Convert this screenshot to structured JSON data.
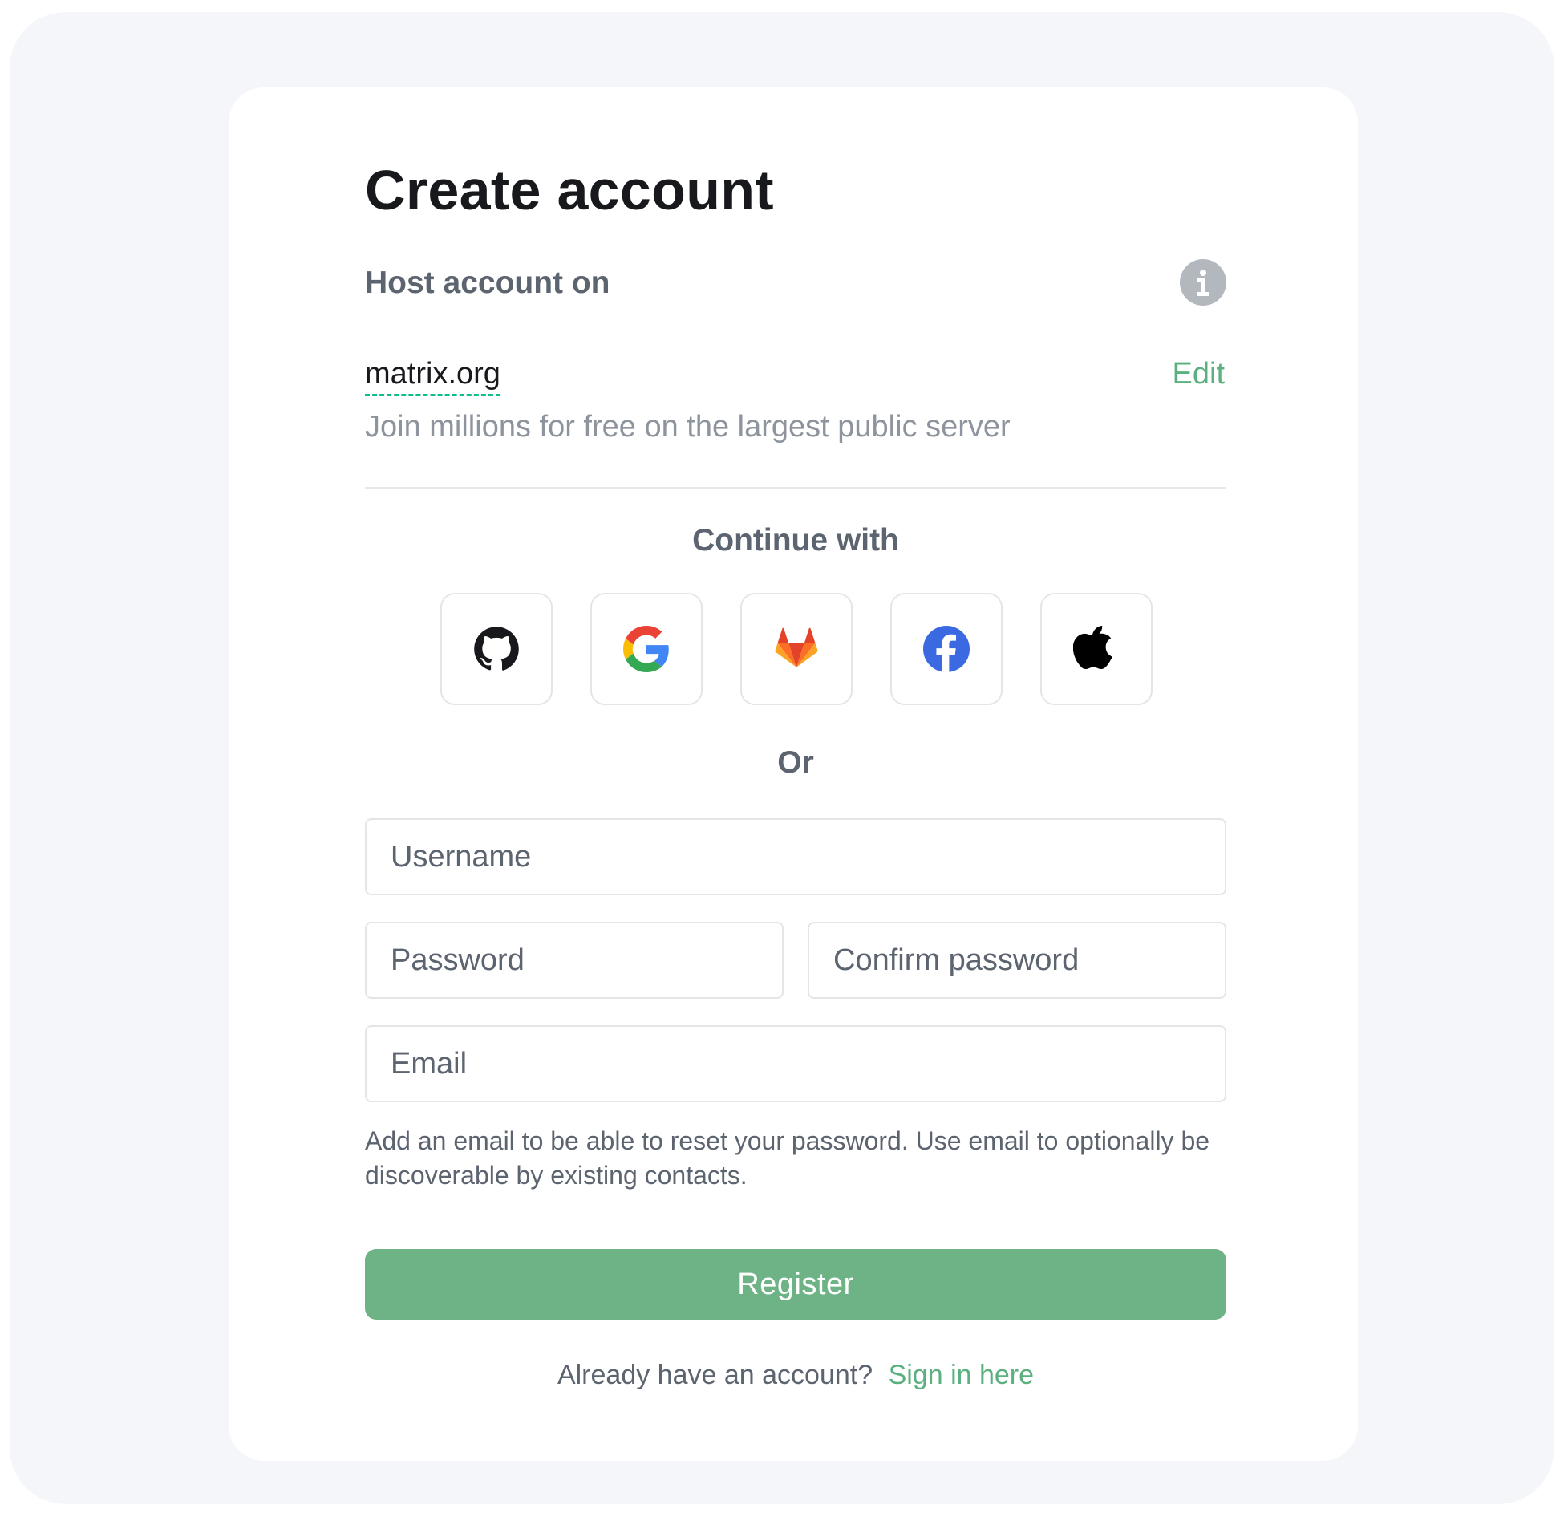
{
  "form": {
    "title": "Create account",
    "host_label": "Host account on",
    "server_name": "matrix.org",
    "edit_label": "Edit",
    "server_description": "Join millions for free on the largest public server",
    "continue_label": "Continue with",
    "sso_providers": [
      {
        "name": "GitHub",
        "icon": "github-icon"
      },
      {
        "name": "Google",
        "icon": "google-icon"
      },
      {
        "name": "GitLab",
        "icon": "gitlab-icon"
      },
      {
        "name": "Facebook",
        "icon": "facebook-icon"
      },
      {
        "name": "Apple",
        "icon": "apple-icon"
      }
    ],
    "or_label": "Or",
    "username_placeholder": "Username",
    "password_placeholder": "Password",
    "confirm_password_placeholder": "Confirm password",
    "email_placeholder": "Email",
    "email_help": "Add an email to be able to reset your password. Use email to optionally be discoverable by existing contacts.",
    "register_label": "Register",
    "signin_prompt": "Already have an account?",
    "signin_link": "Sign in here"
  },
  "colors": {
    "accent": "#0dbd8b",
    "register_button": "#6db385",
    "link": "#5bb080",
    "background": "#f4f6f9",
    "card": "#ffffff",
    "text_primary": "#17191c",
    "text_secondary": "#5c6470"
  }
}
